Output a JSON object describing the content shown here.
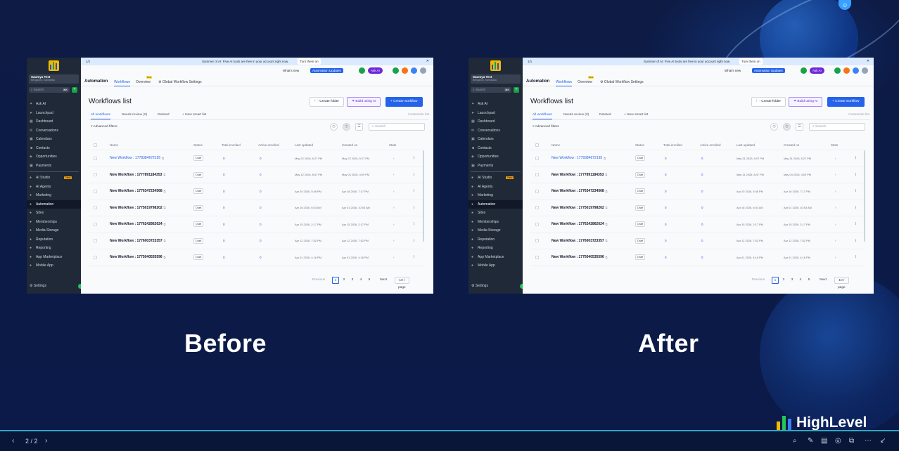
{
  "panels": [
    {
      "label": "Before",
      "banner": {
        "pager": "1/1",
        "message": "Summer of AI: Five AI tools are free in your account right now.",
        "turn_on": "Turn them on"
      },
      "header": {
        "whats_new": "What's new",
        "automation_updates": "Automation Updates",
        "ask_ai": "Ask AI"
      },
      "sidebar": {
        "account_name": "Saumya Test",
        "account_sub": "Bengaluru, Karnataka",
        "search_placeholder": "Search",
        "search_kbd": "⌘K",
        "items": [
          "Ask AI",
          "Launchpad",
          "Dashboard",
          "Conversations",
          "Calendars",
          "Contacts",
          "Opportunities",
          "Payments"
        ],
        "items2": [
          "AI Studio",
          "AI Agents",
          "Marketing",
          "Automation",
          "Sites",
          "Memberships",
          "Media Storage",
          "Reputation",
          "Reporting",
          "App Marketplace",
          "Mobile App"
        ],
        "new_badge": "New",
        "settings": "Settings"
      },
      "module": {
        "title": "Automation",
        "tabs": [
          "Workflows",
          "Overview",
          "Global Workflow Settings"
        ],
        "beta": "Beta"
      },
      "page_title": "Workflows list",
      "buttons": {
        "create_folder": "Create folder",
        "build_ai": "Build using AI",
        "create_workflow": "+ Create workflow"
      },
      "list_tabs": [
        "All workflows",
        "Needs review (0)",
        "Deleted",
        "+ New smart list"
      ],
      "customize": "Customize list",
      "advanced_filters": "Advanced filters",
      "search_placeholder": "Search",
      "columns": [
        "Name",
        "Status",
        "Total enrolled",
        "Active enrolled",
        "Last updated",
        "Created on",
        "Stats"
      ],
      "rows": [
        {
          "name": "New Workflow : 1779384672195",
          "status": "Draft",
          "total": "0",
          "active": "0",
          "updated": "May 22 2026, 5:27 PM",
          "created": "May 22 2026, 5:27 PM"
        },
        {
          "name": "New Workflow : 1777891184353",
          "status": "Draft",
          "total": "0",
          "active": "0",
          "updated": "May 12 2026, 8:47 PM",
          "created": "May 04 2026, 4:09 PM"
        },
        {
          "name": "New Workflow : 1776347234568",
          "status": "Draft",
          "total": "0",
          "active": "0",
          "updated": "Apr 20 2026, 5:48 PM",
          "created": "Apr 16 2026, 7:17 PM"
        },
        {
          "name": "New Workflow : 1775019798202",
          "status": "Draft",
          "total": "0",
          "active": "0",
          "updated": "Apr 16 2026, 6:03 AM",
          "created": "Apr 01 2026, 10:53 AM"
        },
        {
          "name": "New Workflow : 1776242862624",
          "status": "Draft",
          "total": "0",
          "active": "0",
          "updated": "Apr 15 2026, 2:17 PM",
          "created": "Apr 15 2026, 2:17 PM"
        },
        {
          "name": "New Workflow : 1776003723357",
          "status": "Draft",
          "total": "0",
          "active": "0",
          "updated": "Apr 12 2026, 7:52 PM",
          "created": "Apr 12 2026, 7:52 PM"
        },
        {
          "name": "New Workflow : 1775040535596",
          "status": "Draft",
          "total": "0",
          "active": "0",
          "updated": "Apr 01 2026, 4:16 PM",
          "created": "Apr 01 2026, 4:16 PM"
        }
      ],
      "pager": {
        "previous": "Previous",
        "pages": [
          "1",
          "2",
          "3",
          "4",
          "5"
        ],
        "next": "Next",
        "per_page": "10 / page"
      }
    },
    {
      "label": "After",
      "banner": {
        "pager": "1/1",
        "message": "Summer of AI: Five AI tools are free in your account right now.",
        "turn_on": "Turn them on"
      },
      "header": {
        "whats_new": "What's new",
        "automation_updates": "Automation Updates",
        "ask_ai": "Ask AI"
      },
      "sidebar": {
        "account_name": "Saumya Test",
        "account_sub": "Bengaluru, Karnataka",
        "search_placeholder": "Search",
        "search_kbd": "⌘K",
        "items": [
          "Ask AI",
          "Launchpad",
          "Dashboard",
          "Conversations",
          "Calendars",
          "Contacts",
          "Opportunities",
          "Payments"
        ],
        "items2": [
          "AI Studio",
          "AI Agents",
          "Marketing",
          "Automation",
          "Sites",
          "Memberships",
          "Media Storage",
          "Reputation",
          "Reporting",
          "App Marketplace",
          "Mobile App"
        ],
        "new_badge": "New",
        "settings": "Settings"
      },
      "module": {
        "title": "Automation",
        "tabs": [
          "Workflows",
          "Overview",
          "Global Workflow Settings"
        ],
        "beta": "Beta"
      },
      "page_title": "Workflows list",
      "buttons": {
        "create_folder": "Create folder",
        "build_ai": "Build using AI",
        "create_workflow": "+ Create workflow"
      },
      "list_tabs": [
        "All workflows",
        "Needs review (0)",
        "Deleted",
        "+ New smart list"
      ],
      "customize": "Customize list",
      "advanced_filters": "Advanced filters",
      "search_placeholder": "Search",
      "columns": [
        "Name",
        "Status",
        "Total enrolled",
        "Active enrolled",
        "Last updated",
        "Created on",
        "Stats"
      ],
      "rows": [
        {
          "name": "New Workflow : 1779384672195",
          "status": "Draft",
          "total": "0",
          "active": "0",
          "updated": "May 31 2026, 5:07 PM",
          "created": "May 31 2026, 5:27 PM"
        },
        {
          "name": "New Workflow : 1777891184353",
          "status": "Draft",
          "total": "0",
          "active": "0",
          "updated": "May 11 2026, 8:47 PM",
          "created": "May 04 2026, 4:09 PM"
        },
        {
          "name": "New Workflow : 1776347234568",
          "status": "Draft",
          "total": "0",
          "active": "0",
          "updated": "Apr 20 2026, 5:48 PM",
          "created": "Apr 16 2026, 7:17 PM"
        },
        {
          "name": "New Workflow : 1775019798202",
          "status": "Draft",
          "total": "0",
          "active": "0",
          "updated": "Apr 16 2026, 6:01 AM",
          "created": "Apr 01 2026, 10:53 AM"
        },
        {
          "name": "New Workflow : 1776242862624",
          "status": "Draft",
          "total": "0",
          "active": "0",
          "updated": "Apr 15 2026, 2:17 PM",
          "created": "Apr 15 2026, 2:17 PM"
        },
        {
          "name": "New Workflow : 1776003723357",
          "status": "Draft",
          "total": "0",
          "active": "0",
          "updated": "Apr 12 2026, 7:52 PM",
          "created": "Apr 12 2026, 7:52 PM"
        },
        {
          "name": "New Workflow : 1775040535596",
          "status": "Draft",
          "total": "0",
          "active": "0",
          "updated": "Apr 01 2026, 4:16 PM",
          "created": "Apr 01 2026, 4:16 PM"
        }
      ],
      "pager": {
        "previous": "Previous",
        "pages": [
          "1",
          "2",
          "3",
          "4",
          "5"
        ],
        "next": "Next",
        "per_page": "10 / page"
      }
    }
  ],
  "brand": {
    "name": "HighLevel"
  },
  "slide_counter": "2 / 2",
  "colors": {
    "accent": "#2563eb",
    "sidebar": "#1f2937",
    "background": "#0c1a44",
    "footer_line": "#2ea8c6"
  }
}
